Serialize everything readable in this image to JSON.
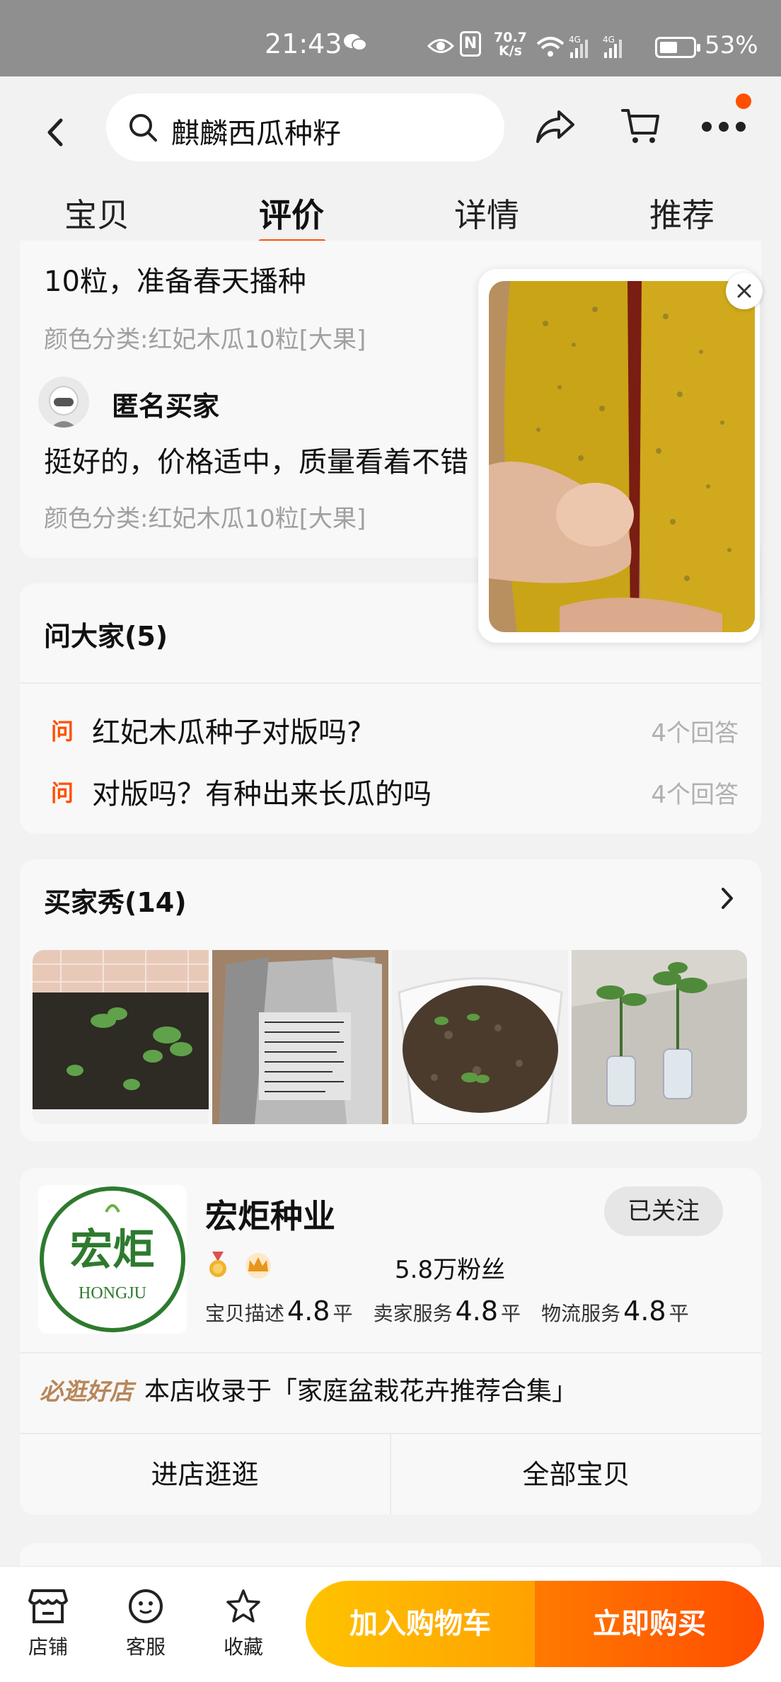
{
  "status_bar": {
    "time": "21:43",
    "net_speed_value": "70.7",
    "net_speed_unit": "K/s",
    "battery": "53%",
    "battery_level": 0.53
  },
  "header": {
    "search_text": "麒麟西瓜种籽",
    "tabs": [
      {
        "label": "宝贝"
      },
      {
        "label": "评价"
      },
      {
        "label": "详情"
      },
      {
        "label": "推荐"
      }
    ],
    "active_tab": "评价",
    "accent": "#ff5000"
  },
  "reviews": {
    "items": [
      {
        "text": "10粒，准备春天播种",
        "category": "颜色分类:红妃木瓜10粒[大果]"
      },
      {
        "user": "匿名买家",
        "text": "挺好的，价格适中，质量看着不错",
        "category": "颜色分类:红妃木瓜10粒[大果]"
      }
    ]
  },
  "qa": {
    "title": "问大家(5)",
    "tag": "问",
    "questions": [
      {
        "text": "红妃木瓜种子对版吗?",
        "answers": "4个回答"
      },
      {
        "text": "对版吗？有种出来长瓜的吗",
        "answers": "4个回答"
      }
    ]
  },
  "buyer_show": {
    "title": "买家秀(14)"
  },
  "store": {
    "name": "宏炬种业",
    "logo_text": "宏炬",
    "logo_subtext": "HONGJU",
    "follow_label": "已关注",
    "fans": "5.8万粉丝",
    "ratings": [
      {
        "label": "宝贝描述",
        "score": "4.8",
        "level": "平"
      },
      {
        "label": "卖家服务",
        "score": "4.8",
        "level": "平"
      },
      {
        "label": "物流服务",
        "score": "4.8",
        "level": "平"
      }
    ],
    "recommend_badge": "必逛好店",
    "recommend_text": "本店收录于「家庭盆栽花卉推荐合集」",
    "enter_store": "进店逛逛",
    "all_items": "全部宝贝"
  },
  "bottom_bar": {
    "shop": "店铺",
    "service": "客服",
    "favorite": "收藏",
    "add_to_cart": "加入购物车",
    "buy_now": "立即购买"
  }
}
